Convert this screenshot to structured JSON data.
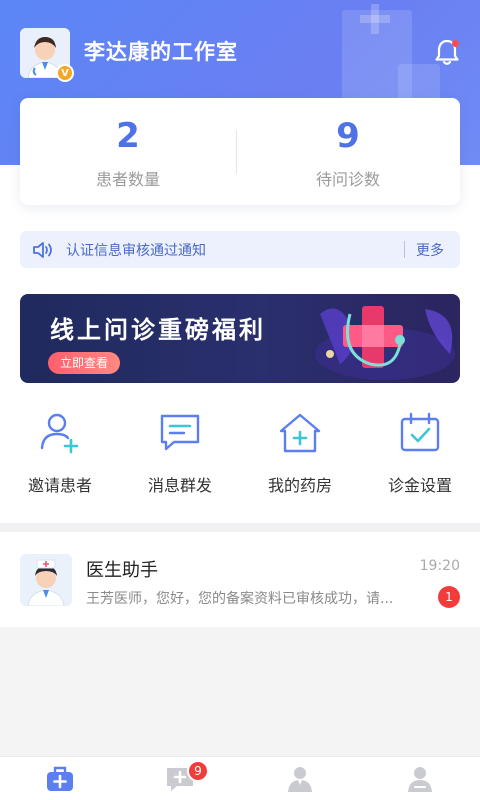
{
  "header": {
    "studio_name": "李达康的工作室",
    "verified_badge": "V",
    "bell_icon": "bell-icon"
  },
  "stats": {
    "patients": {
      "value": "2",
      "label": "患者数量"
    },
    "pending": {
      "value": "9",
      "label": "待问诊数"
    }
  },
  "notice": {
    "icon": "speaker-icon",
    "text": "认证信息审核通过通知",
    "more_label": "更多"
  },
  "banner": {
    "headline": "线上问诊重磅福利",
    "cta_label": "立即查看",
    "active_slide": 1,
    "slide_count": 3
  },
  "actions": [
    {
      "icon": "invite-patient-icon",
      "label": "邀请患者"
    },
    {
      "icon": "broadcast-message-icon",
      "label": "消息群发"
    },
    {
      "icon": "pharmacy-icon",
      "label": "我的药房"
    },
    {
      "icon": "consultation-fee-icon",
      "label": "诊金设置"
    }
  ],
  "messages": [
    {
      "sender": "医生助手",
      "preview": "王芳医师，您好，您的备案资料已审核成功，请...",
      "time": "19:20",
      "unread": "1"
    }
  ],
  "tabbar": {
    "tabs": [
      {
        "icon": "workstation-icon",
        "active": true
      },
      {
        "icon": "messages-icon",
        "active": false
      },
      {
        "icon": "patients-icon",
        "active": false
      },
      {
        "icon": "profile-icon",
        "active": false
      }
    ],
    "messages_badge": "9"
  },
  "colors": {
    "primary": "#5b7ef0",
    "header_gradient_start": "#5b86f6",
    "badge_red": "#f23c3c"
  }
}
